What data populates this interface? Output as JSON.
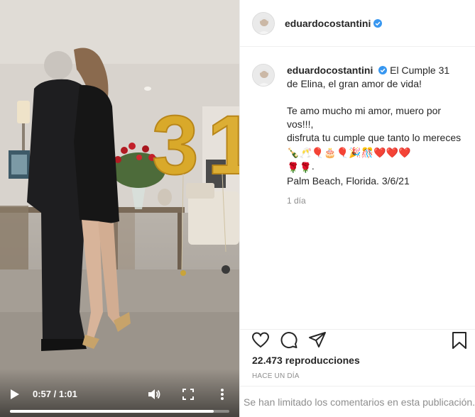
{
  "video": {
    "time": "0:57 / 1:01",
    "progress_fraction": 0.93,
    "balloon_text": "31"
  },
  "post": {
    "username": "eduardocostantini",
    "caption_username": "eduardocostantini",
    "caption_line1": "El Cumple 31 de Elina, el gran amor de vida!",
    "caption_line2": "Te amo mucho mi amor, muero por vos!!!,",
    "caption_line3": "disfruta tu cumple que tanto lo mereces",
    "caption_line4_suffix": ".",
    "caption_line5": "Palm Beach, Florida. 3/6/21",
    "caption_time": "1 día",
    "views": "22.473 reproducciones",
    "posted_ago": "HACE UN DÍA",
    "comments_limited": "Se han limitado los comentarios en esta publicación."
  },
  "icons": {
    "play": "play-icon",
    "volume": "volume-icon",
    "fullscreen": "fullscreen-icon",
    "more": "more-vertical-icon",
    "like": "heart-icon",
    "comment": "comment-icon",
    "share": "send-icon",
    "save": "bookmark-icon",
    "verified": "verified-badge-icon"
  },
  "emojis": [
    "🍾",
    "🥂",
    "🎈",
    "🎂",
    "🎈",
    "🎉",
    "🎊",
    "❤️",
    "❤️",
    "❤️",
    "🌹",
    "🌹"
  ],
  "colors": {
    "verified": "#3897f0",
    "text": "#262626",
    "muted": "#8e8e8e",
    "border": "#efefef",
    "balloon_gold": "#d9a92a"
  }
}
